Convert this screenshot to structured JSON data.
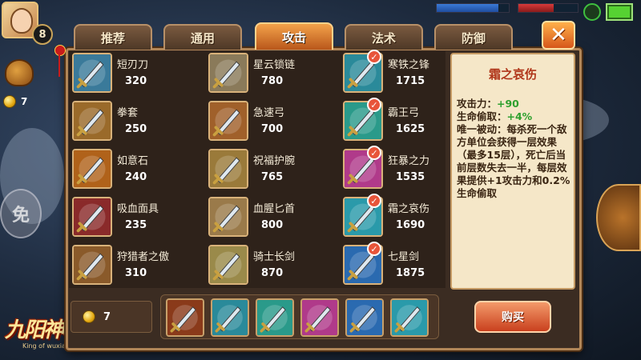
{
  "hud": {
    "level": "8",
    "gold": "7",
    "mian_label": "免",
    "logo": "九阳神功",
    "logo_sub": "King of wuxia",
    "hp_fraction": 0.85,
    "mp_fraction": 0.6
  },
  "tabs": [
    {
      "label": "推荐",
      "active": false
    },
    {
      "label": "通用",
      "active": false
    },
    {
      "label": "攻击",
      "active": true
    },
    {
      "label": "法术",
      "active": false
    },
    {
      "label": "防御",
      "active": false
    }
  ],
  "close_label": "✕",
  "items": [
    {
      "name": "短刃刀",
      "price": "320",
      "owned": false,
      "icon": "dagger-icon",
      "color": "#3a7a9a"
    },
    {
      "name": "星云锁链",
      "price": "780",
      "owned": false,
      "icon": "chain-icon",
      "color": "#8a7a5a"
    },
    {
      "name": "寒铁之锋",
      "price": "1715",
      "owned": true,
      "icon": "ice-sword-icon",
      "color": "#2a8a9a"
    },
    {
      "name": "拳套",
      "price": "250",
      "owned": false,
      "icon": "gauntlet-icon",
      "color": "#9a6a2a"
    },
    {
      "name": "急速弓",
      "price": "700",
      "owned": false,
      "icon": "bow-icon",
      "color": "#a0602a"
    },
    {
      "name": "霸王弓",
      "price": "1625",
      "owned": true,
      "icon": "overlord-bow-icon",
      "color": "#2a9a8a"
    },
    {
      "name": "如意石",
      "price": "240",
      "owned": false,
      "icon": "stone-icon",
      "color": "#b0621a"
    },
    {
      "name": "祝福护腕",
      "price": "765",
      "owned": false,
      "icon": "bracer-icon",
      "color": "#9a7a3a"
    },
    {
      "name": "狂暴之力",
      "price": "1535",
      "owned": true,
      "icon": "fury-blade-icon",
      "color": "#b03a8a"
    },
    {
      "name": "吸血面具",
      "price": "235",
      "owned": false,
      "icon": "mask-icon",
      "color": "#8a2a2a"
    },
    {
      "name": "血腥匕首",
      "price": "800",
      "owned": false,
      "icon": "bloody-dagger-icon",
      "color": "#9a7a4a"
    },
    {
      "name": "霜之哀伤",
      "price": "1690",
      "owned": true,
      "icon": "frostmourne-icon",
      "color": "#2a9aaa"
    },
    {
      "name": "狩猎者之傲",
      "price": "310",
      "owned": false,
      "icon": "hunter-blade-icon",
      "color": "#8a5a2a"
    },
    {
      "name": "骑士长剑",
      "price": "870",
      "owned": false,
      "icon": "knight-sword-icon",
      "color": "#9a8a4a"
    },
    {
      "name": "七星剑",
      "price": "1875",
      "owned": true,
      "icon": "seven-star-sword-icon",
      "color": "#2a6ab0"
    }
  ],
  "detail": {
    "title": "霜之哀伤",
    "attack_label": "攻击力：",
    "attack_value": "+90",
    "lifesteal_label": "生命偷取：",
    "lifesteal_value": "+4%",
    "passive": "唯一被动：每杀死一个敌方单位会获得一层效果（最多15层），死亡后当前层数失去一半，每层效果提供+1攻击力和0.2%生命偷取"
  },
  "bottom": {
    "gold": "7",
    "buy_label": "购买",
    "owned_items": [
      {
        "icon": "boots-icon",
        "color": "#8a3a1a"
      },
      {
        "icon": "ice-sword-icon",
        "color": "#2a8a9a"
      },
      {
        "icon": "overlord-bow-icon",
        "color": "#2a9a8a"
      },
      {
        "icon": "fury-blade-icon",
        "color": "#b03a8a"
      },
      {
        "icon": "seven-star-sword-icon",
        "color": "#2a6ab0"
      },
      {
        "icon": "frostmourne-icon",
        "color": "#2a9aaa"
      }
    ]
  }
}
